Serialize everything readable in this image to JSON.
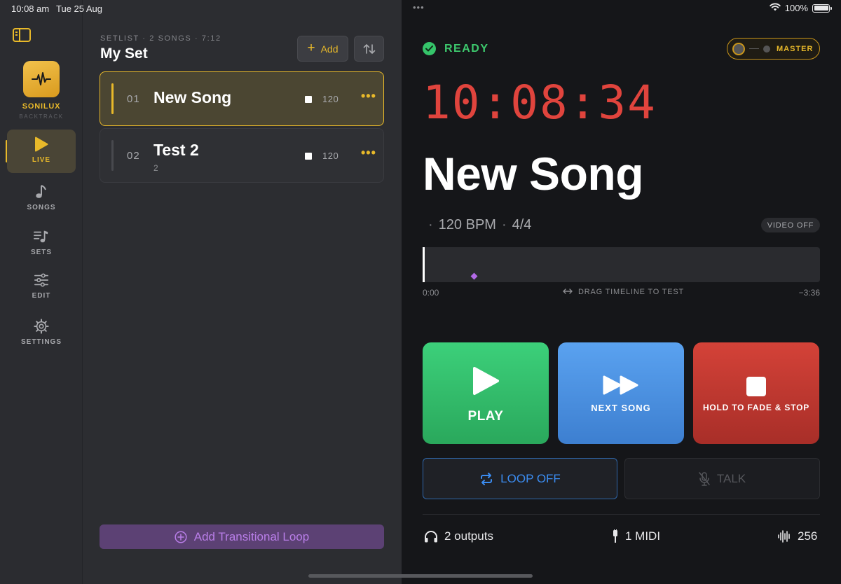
{
  "status_bar": {
    "time": "10:08 am",
    "date": "Tue 25 Aug",
    "dots": "•••",
    "battery": "100%",
    "battery_level": 1.0
  },
  "sidebar": {
    "brand_name": "SONILUX",
    "brand_sub": "BACKTRACK",
    "items": [
      {
        "label": "LIVE",
        "icon": "play-icon",
        "active": true
      },
      {
        "label": "SONGS",
        "icon": "music-note-icon",
        "active": false
      },
      {
        "label": "SETS",
        "icon": "setlist-icon",
        "active": false
      },
      {
        "label": "EDIT",
        "icon": "sliders-icon",
        "active": false
      },
      {
        "label": "SETTINGS",
        "icon": "gear-icon",
        "active": false
      }
    ]
  },
  "setlist": {
    "meta": "SETLIST · 2 SONGS · 7:12",
    "title": "My Set",
    "add_label": "Add",
    "add_symbol": "+",
    "songs": [
      {
        "num": "01",
        "title": "New Song",
        "subtitle": "",
        "bpm": "120",
        "more": "•••",
        "selected": true
      },
      {
        "num": "02",
        "title": "Test 2",
        "subtitle": "2",
        "bpm": "120",
        "more": "•••",
        "selected": false
      }
    ],
    "transitional_loop_label": "Add Transitional Loop"
  },
  "live": {
    "status": "READY",
    "master_label": "MASTER",
    "clock": "10:08:34",
    "song_title": "New Song",
    "info_sep": "·",
    "bpm": "120 BPM",
    "time_sig": "4/4",
    "video_label": "VIDEO OFF",
    "timeline": {
      "start": "0:00",
      "hint": "DRAG TIMELINE TO TEST",
      "end": "−3:36"
    },
    "buttons": {
      "play": "PLAY",
      "next": "NEXT SONG",
      "stop": "HOLD TO FADE & STOP"
    },
    "loop_label": "LOOP OFF",
    "talk_label": "TALK",
    "footer": {
      "outputs": "2 outputs",
      "midi": "1 MIDI",
      "buffer": "256"
    }
  },
  "colors": {
    "accent": "#e8b92a",
    "ready": "#3dc86d",
    "clock": "#e0443d",
    "play": "#35c46a",
    "next": "#4a90e2",
    "stop": "#c23a31",
    "loop": "#3b8cf0",
    "transitional": "#b97ee8"
  }
}
